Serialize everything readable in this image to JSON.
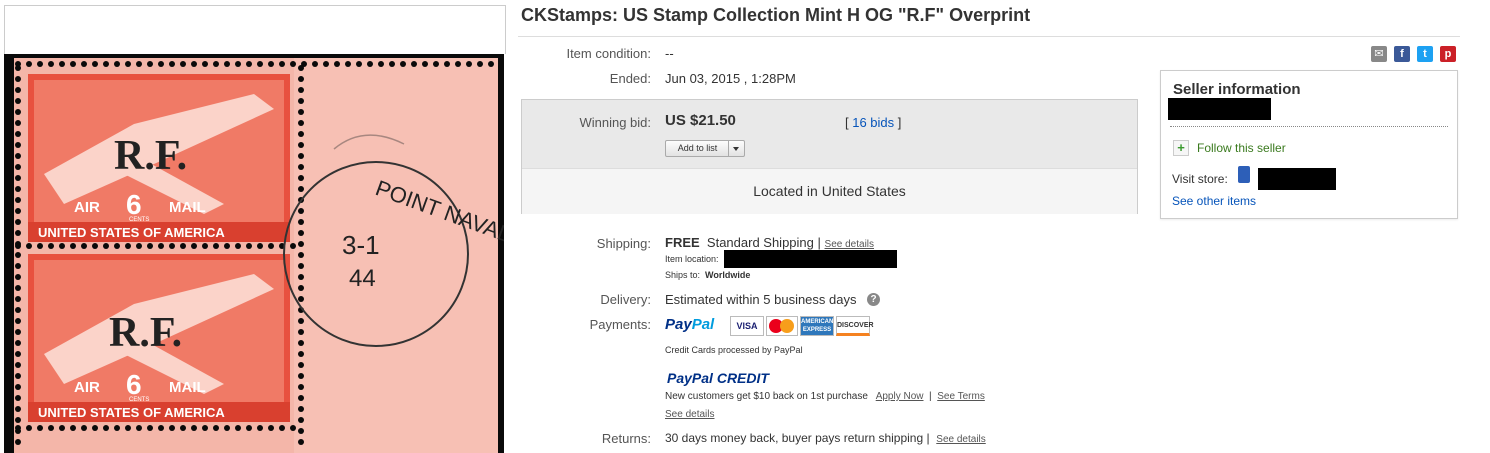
{
  "listing": {
    "title": "CKStamps: US Stamp Collection Mint H OG \"R.F\" Overprint"
  },
  "image": {
    "stamp_text_top": "R.F.",
    "stamp_text_air": "AIR",
    "stamp_value": "6",
    "stamp_cents": "CENTS",
    "stamp_mail": "MAIL",
    "stamp_country": "UNITED STATES OF AMERICA",
    "postmark_text": "POINT NAVALE",
    "postmark_date1": "3-1",
    "postmark_date2": "44"
  },
  "details": {
    "condition_label": "Item condition:",
    "condition_value": "--",
    "ended_label": "Ended:",
    "ended_value": "Jun 03, 2015 , 1:28PM"
  },
  "bid": {
    "label": "Winning bid:",
    "amount": "US $21.50",
    "bids_open": "[ ",
    "bids_link": "16 bids",
    "bids_close": " ]",
    "add_to_list": "Add to list",
    "location": "Located in United States"
  },
  "shipping": {
    "label": "Shipping:",
    "free": "FREE",
    "method": "Standard Shipping",
    "sep": "|",
    "see_details": "See details",
    "item_location_label": "Item location:",
    "ships_to_label": "Ships to:",
    "ships_to_value": "Worldwide"
  },
  "delivery": {
    "label": "Delivery:",
    "value": "Estimated within 5 business days",
    "help_icon": "?"
  },
  "payments": {
    "label": "Payments:",
    "paypal_logo_pay": "Pay",
    "paypal_logo_pal": "Pal",
    "cards": [
      "VISA",
      "MasterCard",
      "AMERICAN EXPRESS",
      "DISCOVER"
    ],
    "card_note": "Credit Cards processed by PayPal",
    "credit_pay": "PayPal",
    "credit_word": "CREDIT",
    "promo": "New customers get $10 back on 1st purchase",
    "apply_now": "Apply Now",
    "see_terms": "See Terms",
    "see_details": "See details"
  },
  "returns": {
    "label": "Returns:",
    "value": "30 days money back, buyer pays return shipping |",
    "see_details": "See details"
  },
  "seller": {
    "heading": "Seller information",
    "follow": "Follow this seller",
    "visit_store": "Visit store:",
    "other_items": "See other items"
  },
  "social_icons": [
    "email-icon",
    "facebook-icon",
    "twitter-icon",
    "pinterest-icon"
  ],
  "colors": {
    "link": "#0654ba",
    "stamp_red": "#e8513f",
    "paypal_dark": "#003087",
    "paypal_light": "#009cde"
  }
}
